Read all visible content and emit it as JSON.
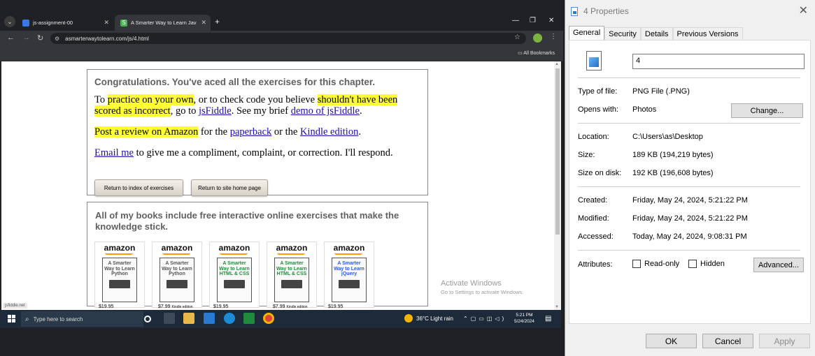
{
  "browser": {
    "tabs": [
      {
        "label": "js-assignment-00",
        "active": false
      },
      {
        "label": "A Smarter Way to Learn JavaScript",
        "active": true
      }
    ],
    "new_tab": "+",
    "url": "asmarterwaytolearn.com/js/4.html",
    "bookmarks_label": "All Bookmarks"
  },
  "page": {
    "congrats_heading": "Congratulations. You've aced all the exercises for this chapter.",
    "p1": {
      "t1": "To ",
      "hl1": "practice on your own",
      "t2": ", or to check code you believe ",
      "hl2": "shouldn't have been scored as incorrect",
      "t3": ", go to ",
      "link1": "jsFiddle",
      "t4": ". See my brief ",
      "link2": "demo of jsFiddle",
      "t5": "."
    },
    "p2": {
      "hl": "Post a review on Amazon",
      "t1": " for the ",
      "link1": "paperback",
      "t2": " or the ",
      "link2": "Kindle edition",
      "t3": "."
    },
    "p3": {
      "link": "Email me",
      "t1": " to give me a compliment, complaint, or correction. I'll respond."
    },
    "btn_index": "Return to index of exercises",
    "btn_home": "Return to site home page",
    "books_heading": "All of my books include free interactive online exercises that make the knowledge stick.",
    "books": [
      {
        "logo": "amazon",
        "title": "A Smarter Way to Learn Python",
        "price": "$19.95",
        "kindle": "",
        "color": "#555555"
      },
      {
        "logo": "amazon",
        "title": "A Smarter Way to Learn Python",
        "price": "$7.99",
        "kindle": "Kindle edition",
        "color": "#555555"
      },
      {
        "logo": "amazon",
        "title": "A Smarter Way to Learn HTML & CSS",
        "price": "$19.95",
        "kindle": "",
        "color": "#1e8c3a"
      },
      {
        "logo": "amazon",
        "title": "A Smarter Way to Learn HTML & CSS",
        "price": "$7.99",
        "kindle": "Kindle edition",
        "color": "#1e8c3a"
      },
      {
        "logo": "amazon",
        "title": "A Smarter Way to Learn jQuery",
        "price": "$19.95",
        "kindle": "",
        "color": "#2a5bd7"
      }
    ],
    "status_text": "jsfiddle.net"
  },
  "activate": {
    "line1": "Activate Windows",
    "line2": "Go to Settings to activate Windows."
  },
  "taskbar": {
    "search_placeholder": "Type here to search",
    "weather": "36°C  Light rain",
    "time": "5:21 PM",
    "date": "5/24/2024"
  },
  "dialog": {
    "title": "4 Properties",
    "tabs": [
      "General",
      "Security",
      "Details",
      "Previous Versions"
    ],
    "name_value": "4",
    "rows": {
      "type_label": "Type of file:",
      "type_value": "PNG File (.PNG)",
      "opens_label": "Opens with:",
      "opens_value": "Photos",
      "change_btn": "Change...",
      "location_label": "Location:",
      "location_value": "C:\\Users\\as\\Desktop",
      "size_label": "Size:",
      "size_value": "189 KB (194,219 bytes)",
      "sizedisk_label": "Size on disk:",
      "sizedisk_value": "192 KB (196,608 bytes)",
      "created_label": "Created:",
      "created_value": "Friday, May 24, 2024, 5:21:22 PM",
      "modified_label": "Modified:",
      "modified_value": "Friday, May 24, 2024, 5:21:22 PM",
      "accessed_label": "Accessed:",
      "accessed_value": "Today, May 24, 2024, 9:08:31 PM",
      "attributes_label": "Attributes:",
      "readonly_label": "Read-only",
      "hidden_label": "Hidden",
      "advanced_btn": "Advanced..."
    },
    "ok": "OK",
    "cancel": "Cancel",
    "apply": "Apply"
  },
  "colors": {
    "highlight": "#ffff33",
    "link": "#1a0dab",
    "amazon_orange": "#ff9900"
  }
}
